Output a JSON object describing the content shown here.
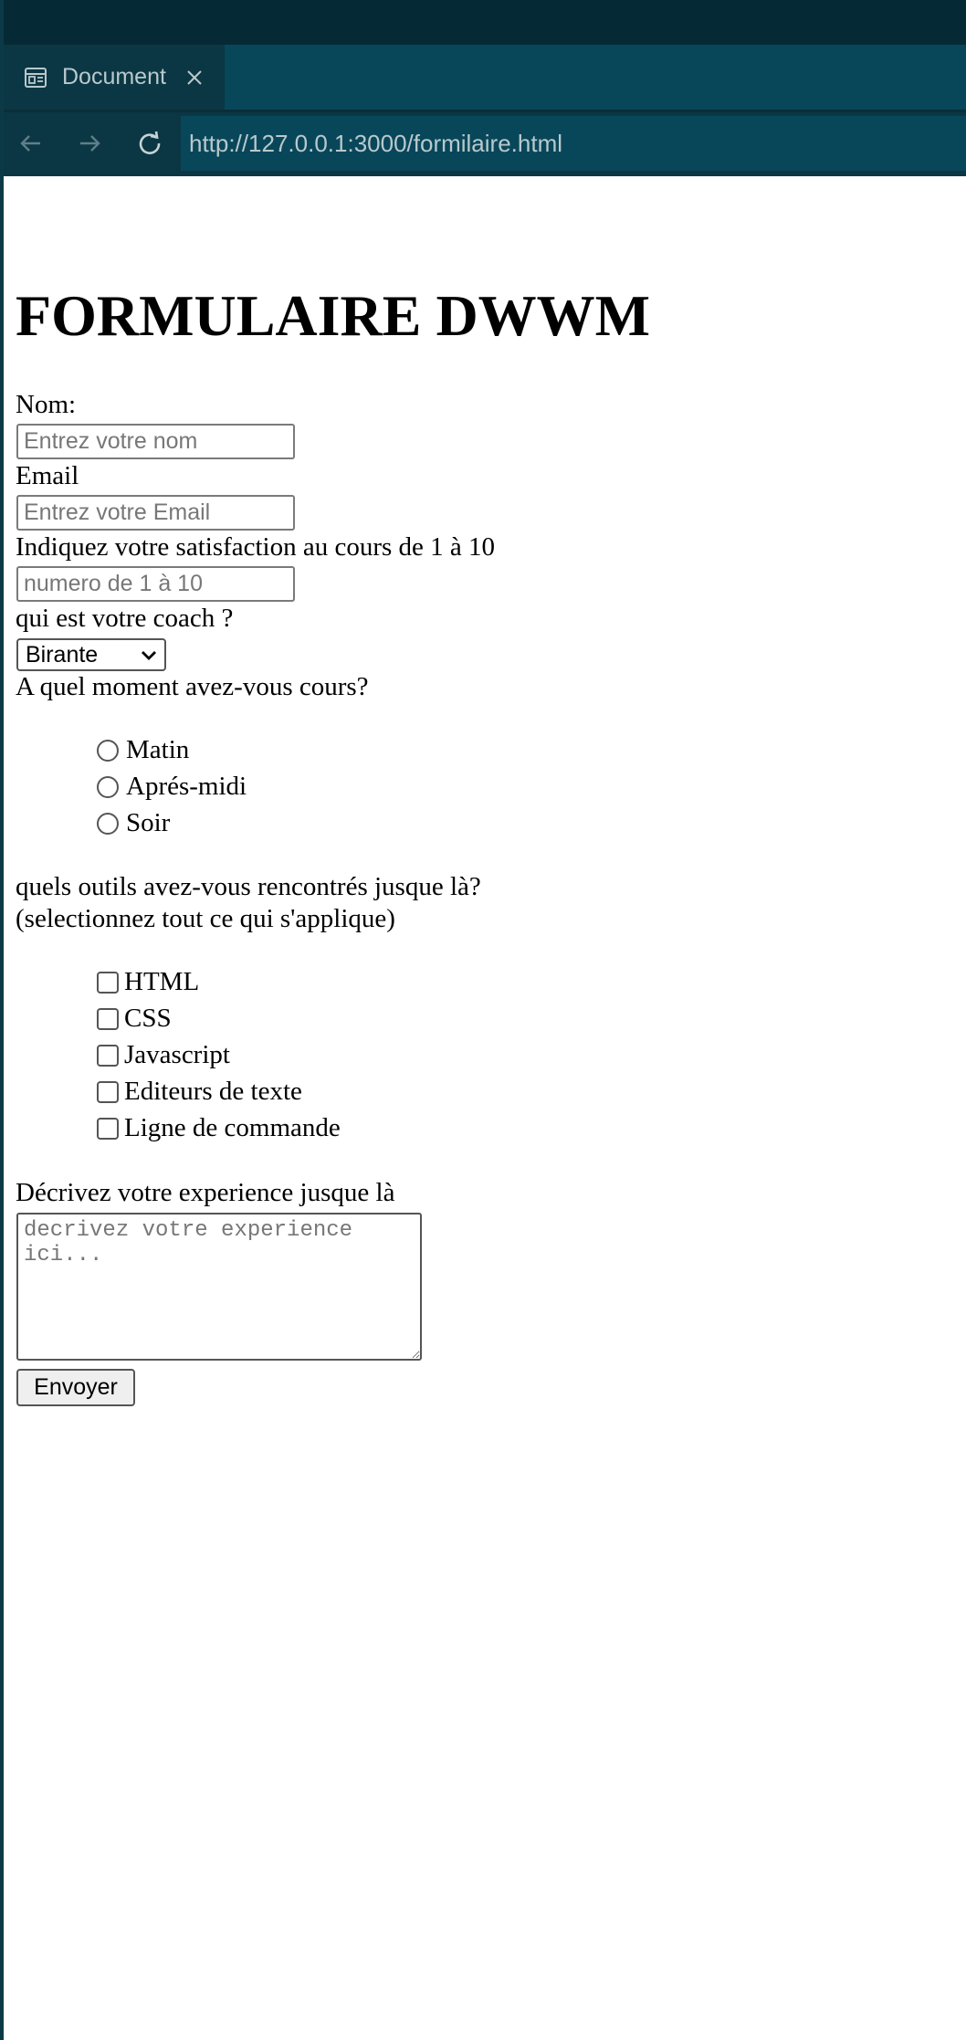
{
  "browser": {
    "tab_title": "Document",
    "url": "http://127.0.0.1:3000/formilaire.html",
    "colors": {
      "titlebar": "#062a35",
      "tabstrip": "#08475a",
      "active_tab": "#0b3744",
      "text": "#b9c9cd"
    },
    "icons": {
      "tab": "document-icon",
      "close": "close-icon",
      "back": "arrow-left-icon",
      "forward": "arrow-right-icon",
      "reload": "reload-icon"
    }
  },
  "form": {
    "title": "FORMULAIRE DWWM",
    "name_label": "Nom:",
    "name_placeholder": "Entrez votre nom",
    "email_label": "Email",
    "email_placeholder": "Entrez votre Email",
    "satisfaction_label": "Indiquez votre satisfaction au cours de 1 à 10",
    "satisfaction_placeholder": "numero de 1 à 10",
    "coach_label": "qui est votre coach ?",
    "coach_selected": "Birante",
    "moment_label": "A quel moment avez-vous cours?",
    "moment_options": [
      "Matin",
      "Aprés-midi",
      "Soir"
    ],
    "tools_label_line1": "quels outils avez-vous rencontrés jusque là?",
    "tools_label_line2": "(selectionnez tout ce qui s'applique)",
    "tools_options": [
      "HTML",
      "CSS",
      "Javascript",
      "Editeurs de texte",
      "Ligne de commande"
    ],
    "experience_label": "Décrivez votre experience jusque là",
    "experience_placeholder": "decrivez votre experience ici...",
    "submit_label": "Envoyer"
  }
}
